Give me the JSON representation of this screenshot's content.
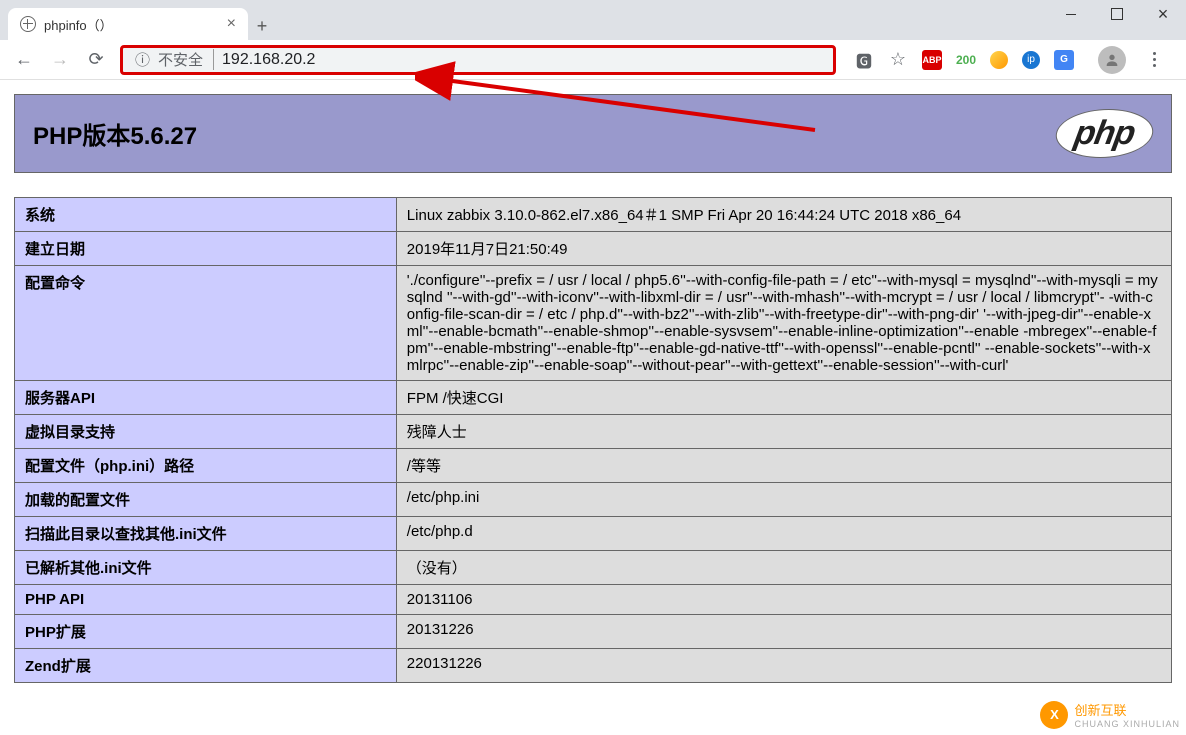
{
  "window": {
    "tab_title": "phpinfo（）",
    "not_secure_label": "不安全",
    "url": "192.168.20.2"
  },
  "extensions": {
    "abp": "ABP",
    "status": "200",
    "gt": "G"
  },
  "phpinfo": {
    "title": "PHP版本5.6.27",
    "logo_text": "php",
    "rows": [
      {
        "key": "系统",
        "val": "Linux zabbix 3.10.0-862.el7.x86_64＃1 SMP Fri Apr 20 16:44:24 UTC 2018 x86_64"
      },
      {
        "key": "建立日期",
        "val": "2019年11月7日21:50:49"
      },
      {
        "key": "配置命令",
        "val": "'./configure''--prefix = / usr / local / php5.6''--with-config-file-path = / etc''--with-mysql = mysqlnd''--with-mysqli = mysqlnd ''--with-gd''--with-iconv''--with-libxml-dir = / usr''--with-mhash''--with-mcrypt = / usr / local / libmcrypt''- -with-config-file-scan-dir = / etc / php.d''--with-bz2''--with-zlib''--with-freetype-dir''--with-png-dir' '--with-jpeg-dir''--enable-xml''--enable-bcmath''--enable-shmop''--enable-sysvsem''--enable-inline-optimization''--enable -mbregex''--enable-fpm''--enable-mbstring''--enable-ftp''--enable-gd-native-ttf''--with-openssl''--enable-pcntl'' --enable-sockets''--with-xmlrpc''--enable-zip''--enable-soap''--without-pear''--with-gettext''--enable-session''--with-curl'"
      },
      {
        "key": "服务器API",
        "val": "FPM /快速CGI"
      },
      {
        "key": "虚拟目录支持",
        "val": "残障人士"
      },
      {
        "key": "配置文件（php.ini）路径",
        "val": "/等等"
      },
      {
        "key": "加载的配置文件",
        "val": "/etc/php.ini"
      },
      {
        "key": "扫描此目录以查找其他.ini文件",
        "val": "/etc/php.d"
      },
      {
        "key": "已解析其他.ini文件",
        "val": "（没有）"
      },
      {
        "key": "PHP API",
        "val": "20131106"
      },
      {
        "key": "PHP扩展",
        "val": "20131226"
      },
      {
        "key": "Zend扩展",
        "val": "220131226"
      }
    ]
  },
  "watermark": {
    "text": "创新互联",
    "sub": "CHUANG XINHULIAN",
    "icon": "X"
  }
}
